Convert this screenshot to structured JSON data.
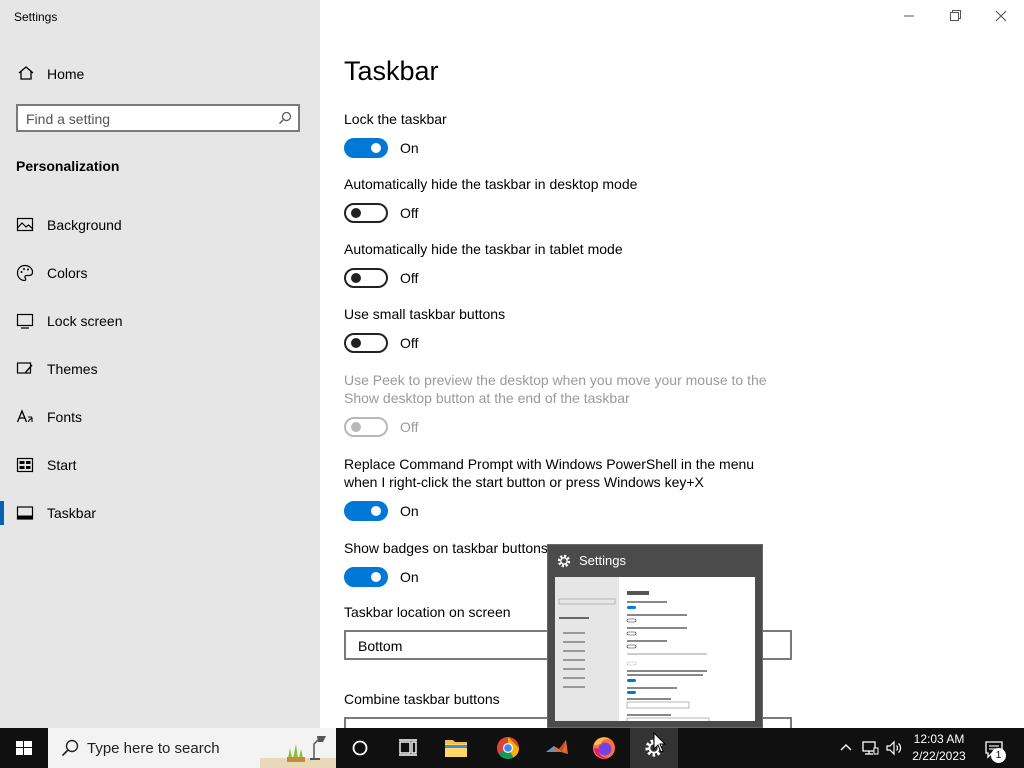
{
  "window": {
    "title": "Settings",
    "controls": [
      "minimize",
      "restore",
      "close"
    ]
  },
  "sidebar": {
    "home_label": "Home",
    "search_placeholder": "Find a setting",
    "section": "Personalization",
    "items": [
      {
        "label": "Background",
        "icon": "background-icon",
        "active": false
      },
      {
        "label": "Colors",
        "icon": "palette-icon",
        "active": false
      },
      {
        "label": "Lock screen",
        "icon": "lock-screen-icon",
        "active": false
      },
      {
        "label": "Themes",
        "icon": "themes-icon",
        "active": false
      },
      {
        "label": "Fonts",
        "icon": "fonts-icon",
        "active": false
      },
      {
        "label": "Start",
        "icon": "start-icon",
        "active": false
      },
      {
        "label": "Taskbar",
        "icon": "taskbar-icon",
        "active": true
      }
    ]
  },
  "main": {
    "title": "Taskbar",
    "settings": [
      {
        "label": "Lock the taskbar",
        "state": "On"
      },
      {
        "label": "Automatically hide the taskbar in desktop mode",
        "state": "Off"
      },
      {
        "label": "Automatically hide the taskbar in tablet mode",
        "state": "Off"
      },
      {
        "label": "Use small taskbar buttons",
        "state": "Off"
      },
      {
        "label_line1": "Use Peek to preview the desktop when you move your mouse to the",
        "label_line2": "Show desktop button at the end of the taskbar",
        "state": "Off",
        "disabled": true
      },
      {
        "label_line1": "Replace Command Prompt with Windows PowerShell in the menu",
        "label_line2": "when I right-click the start button or press Windows key+X",
        "state": "On"
      },
      {
        "label": "Show badges on taskbar buttons",
        "state": "On"
      }
    ],
    "location_label": "Taskbar location on screen",
    "location_value": "Bottom",
    "combine_label": "Combine taskbar buttons"
  },
  "preview": {
    "title": "Settings"
  },
  "taskbar": {
    "search_placeholder": "Type here to search",
    "apps": [
      "cortana-icon",
      "task-view-icon",
      "file-explorer-icon",
      "chrome-icon",
      "matlab-icon",
      "firefox-icon",
      "settings-icon"
    ],
    "time": "12:03 AM",
    "date": "2/22/2023",
    "notification_count": "1"
  },
  "colors": {
    "accent": "#0078d7",
    "sidebar_bg": "#e6e6e6",
    "taskbar_bg": "#101010"
  }
}
